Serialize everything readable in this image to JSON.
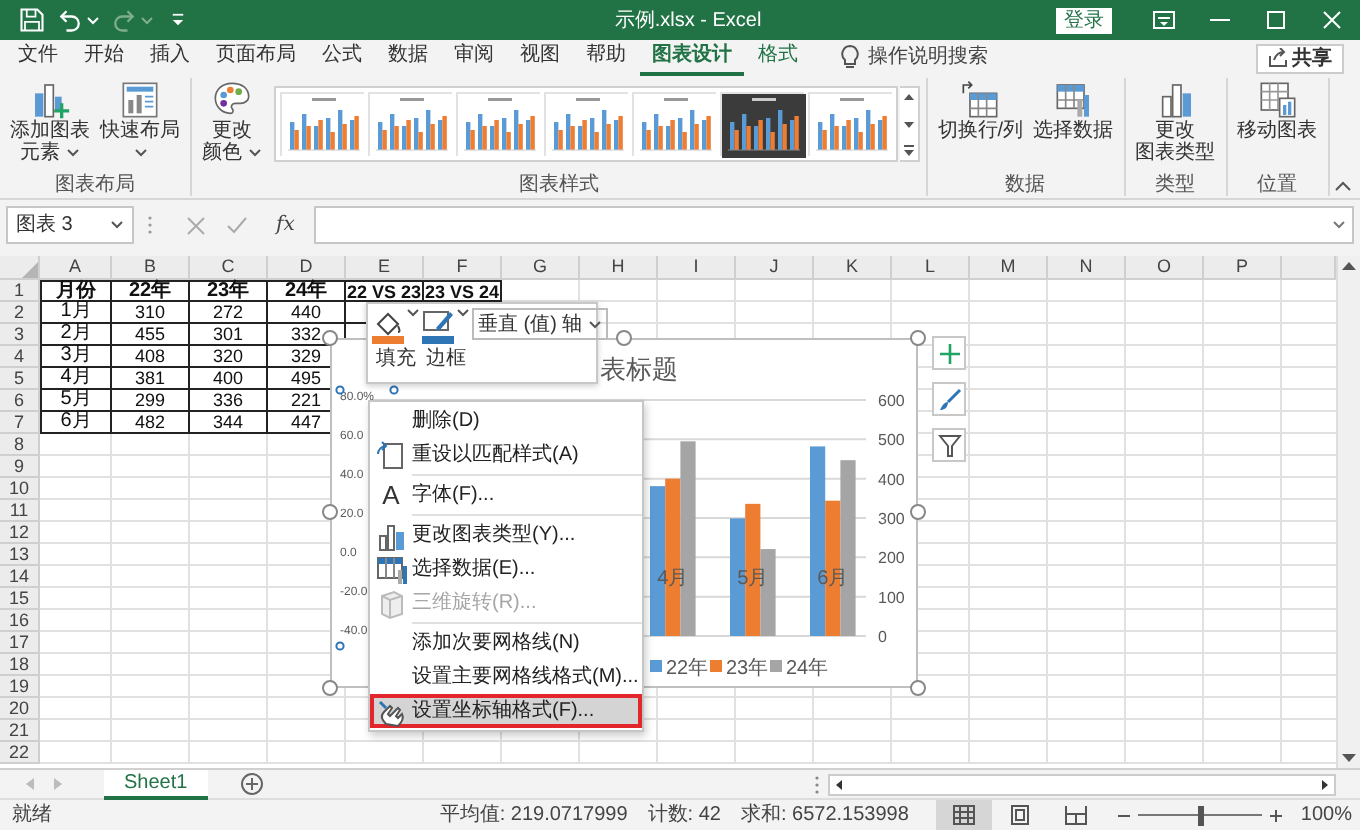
{
  "title_bar": {
    "quick_access": [
      {
        "kind": "save",
        "disabled": false
      },
      {
        "kind": "undo",
        "disabled": false
      },
      {
        "kind": "redo",
        "disabled": true
      },
      {
        "kind": "customize",
        "disabled": false
      }
    ],
    "title": "示例.xlsx - Excel",
    "sign_in": "登录"
  },
  "ribbon": {
    "tabs": [
      {
        "label": "文件",
        "selected": false,
        "contextual": false
      },
      {
        "label": "开始",
        "selected": false,
        "contextual": false
      },
      {
        "label": "插入",
        "selected": false,
        "contextual": false
      },
      {
        "label": "页面布局",
        "selected": false,
        "contextual": false
      },
      {
        "label": "公式",
        "selected": false,
        "contextual": false
      },
      {
        "label": "数据",
        "selected": false,
        "contextual": false
      },
      {
        "label": "审阅",
        "selected": false,
        "contextual": false
      },
      {
        "label": "视图",
        "selected": false,
        "contextual": false
      },
      {
        "label": "帮助",
        "selected": false,
        "contextual": false
      },
      {
        "label": "图表设计",
        "selected": true,
        "contextual": true
      },
      {
        "label": "格式",
        "selected": false,
        "contextual": true
      }
    ],
    "tell_me": "操作说明搜索",
    "share": "共享",
    "groups": [
      {
        "label": "图表布局",
        "buttons": [
          {
            "kind": "add-element",
            "lines": [
              "添加图表",
              "元素"
            ],
            "dropdown": true
          },
          {
            "kind": "quick-layout",
            "lines": [
              "快速布局"
            ],
            "dropdown": true
          }
        ]
      },
      {
        "label": "图表样式",
        "buttons": [
          {
            "kind": "change-colors",
            "lines": [
              "更改",
              "颜色"
            ],
            "dropdown": true
          }
        ],
        "styles": [
          {
            "kind": "light"
          },
          {
            "kind": "light"
          },
          {
            "kind": "light"
          },
          {
            "kind": "light"
          },
          {
            "kind": "light"
          },
          {
            "kind": "dark"
          },
          {
            "kind": "light"
          }
        ]
      },
      {
        "label": "数据",
        "buttons": [
          {
            "kind": "switch-row-column",
            "lines": [
              "切换行/列"
            ],
            "dropdown": false
          },
          {
            "kind": "select-data",
            "lines": [
              "选择数据"
            ],
            "dropdown": false
          }
        ]
      },
      {
        "label": "类型",
        "buttons": [
          {
            "kind": "change-chart-type",
            "lines": [
              "更改",
              "图表类型"
            ],
            "dropdown": false
          }
        ]
      },
      {
        "label": "位置",
        "buttons": [
          {
            "kind": "move-chart",
            "lines": [
              "移动图表"
            ],
            "dropdown": false
          }
        ]
      }
    ]
  },
  "formula_bar": {
    "name_box": "图表 3",
    "function_label": "fx"
  },
  "sheet": {
    "columns": [
      "A",
      "B",
      "C",
      "D",
      "E",
      "F",
      "G",
      "H",
      "I",
      "J",
      "K",
      "L",
      "M",
      "N",
      "O",
      "P"
    ],
    "rows": [
      "1",
      "2",
      "3",
      "4",
      "5",
      "6",
      "7",
      "8",
      "9",
      "10",
      "11",
      "12",
      "13",
      "14",
      "15",
      "16",
      "17",
      "18",
      "19",
      "20",
      "21",
      "22"
    ],
    "cells": [
      [
        "月份",
        "22年",
        "23年",
        "24年",
        "22 VS 23",
        "23 VS 24"
      ],
      [
        "1月",
        "310",
        "272",
        "440"
      ],
      [
        "2月",
        "455",
        "301",
        "332"
      ],
      [
        "3月",
        "408",
        "320",
        "329"
      ],
      [
        "4月",
        "381",
        "400",
        "495"
      ],
      [
        "5月",
        "299",
        "336",
        "221"
      ],
      [
        "6月",
        "482",
        "344",
        "447"
      ]
    ]
  },
  "chart": {
    "title": "表标题",
    "left_axis_labels": [
      "80.0%",
      "60.0",
      "40.0",
      "20.0",
      "0.0",
      "-20.0",
      "-40.0"
    ],
    "chart_data": {
      "type": "bar",
      "categories": [
        "4月",
        "5月",
        "6月"
      ],
      "series": [
        {
          "name": "22年",
          "color": "#5b9bd5",
          "values": [
            381,
            299,
            482
          ]
        },
        {
          "name": "23年",
          "color": "#ed7d31",
          "values": [
            400,
            336,
            344
          ]
        },
        {
          "name": "24年",
          "color": "#a5a5a5",
          "values": [
            495,
            221,
            447
          ]
        }
      ],
      "ylim": [
        0,
        600
      ],
      "yticks": [
        {
          "value": 0,
          "label": "0"
        },
        {
          "value": 100,
          "label": "100"
        },
        {
          "value": 200,
          "label": "200"
        },
        {
          "value": 300,
          "label": "300"
        },
        {
          "value": 400,
          "label": "400"
        },
        {
          "value": 500,
          "label": "500"
        },
        {
          "value": 600,
          "label": "600"
        }
      ],
      "grid": true,
      "legend": "bottom"
    }
  },
  "mini_toolbar": {
    "fill_label": "填充",
    "outline_label": "边框",
    "element_select": "垂直 (值) 轴"
  },
  "context_menu": {
    "groups": [
      [
        {
          "kind": "plain",
          "label": "删除(D)",
          "disabled": false,
          "selected": false
        },
        {
          "kind": "reset",
          "label": "重设以匹配样式(A)",
          "disabled": false,
          "selected": false
        }
      ],
      [
        {
          "kind": "font",
          "icon_glyph": "A",
          "label": "字体(F)...",
          "disabled": false,
          "selected": false
        }
      ],
      [
        {
          "kind": "chart-type",
          "label": "更改图表类型(Y)...",
          "disabled": false,
          "selected": false
        },
        {
          "kind": "select-data",
          "label": "选择数据(E)...",
          "disabled": false,
          "selected": false
        },
        {
          "kind": "rotate-3d",
          "label": "三维旋转(R)...",
          "disabled": true,
          "selected": false
        }
      ],
      [
        {
          "kind": "plain",
          "label": "添加次要网格线(N)",
          "disabled": false,
          "selected": false
        },
        {
          "kind": "plain",
          "label": "设置主要网格线格式(M)...",
          "disabled": false,
          "selected": false
        },
        {
          "kind": "format",
          "label": "设置坐标轴格式(F)...",
          "disabled": false,
          "selected": true
        }
      ]
    ]
  },
  "sheet_tabs": {
    "tabs": [
      {
        "label": "Sheet1",
        "selected": true
      }
    ]
  },
  "status_bar": {
    "status": "就绪",
    "average": "平均值: 219.0717999",
    "count": "计数: 42",
    "sum": "求和: 6572.153998",
    "views": [
      {
        "selected": true
      },
      {
        "selected": false
      },
      {
        "selected": false
      }
    ],
    "zoom": {
      "level": 0.5,
      "reading": "100%"
    }
  }
}
